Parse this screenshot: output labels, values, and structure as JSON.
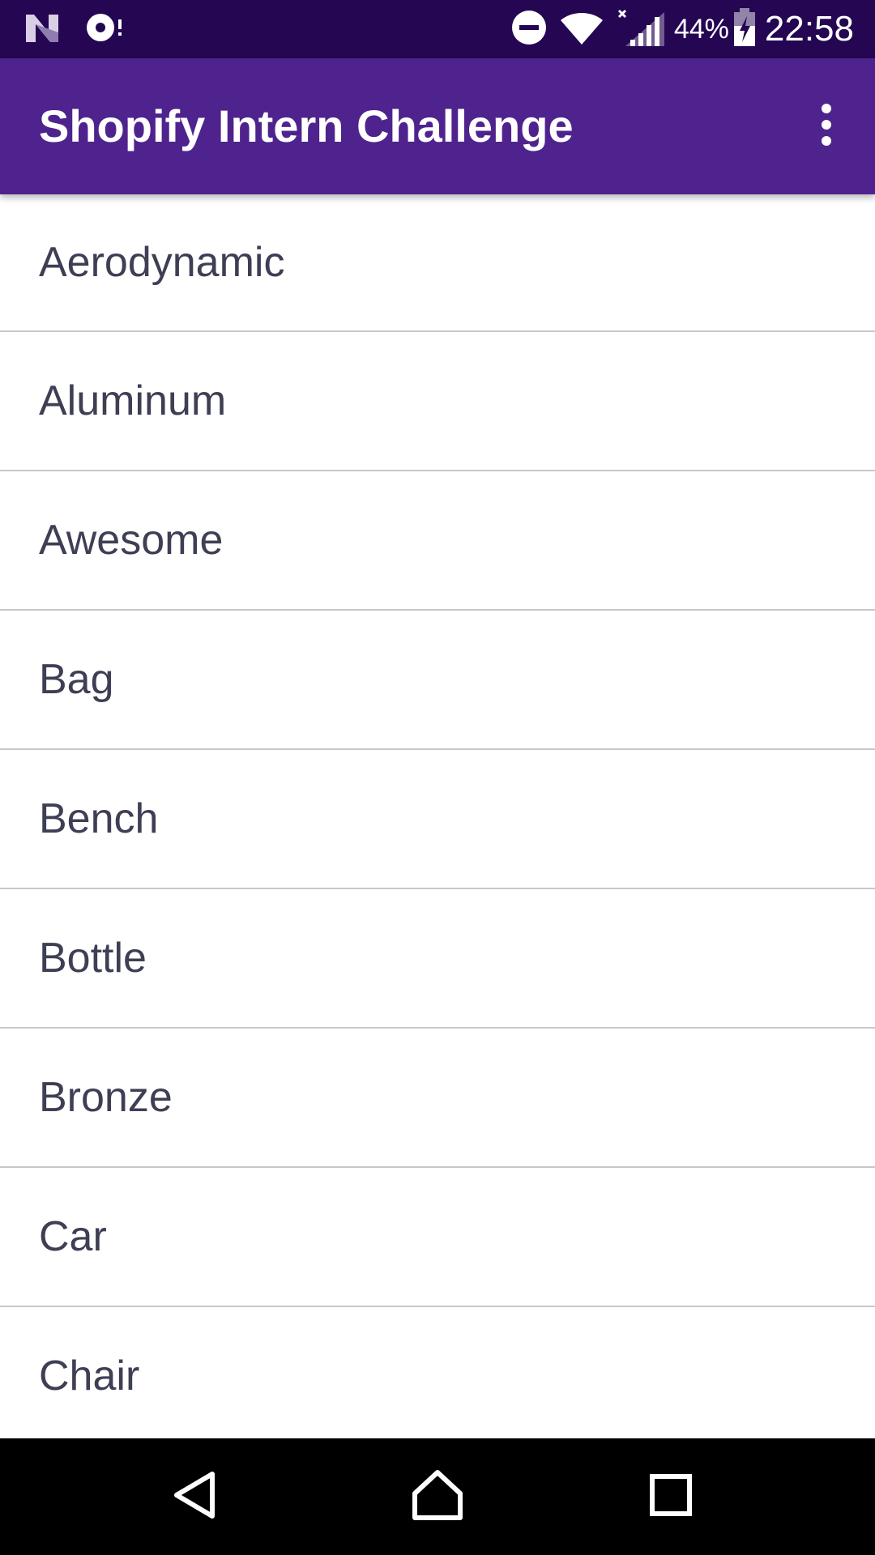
{
  "status_bar": {
    "battery_percent": "44%",
    "time": "22:58",
    "icons": [
      "notification-n-icon",
      "media-icon",
      "do-not-disturb-icon",
      "wifi-icon",
      "cellular-signal-icon",
      "battery-charging-icon"
    ]
  },
  "app_bar": {
    "title": "Shopify Intern Challenge",
    "overflow_icon": "more-vert-icon"
  },
  "list": {
    "items": [
      {
        "label": "Aerodynamic"
      },
      {
        "label": "Aluminum"
      },
      {
        "label": "Awesome"
      },
      {
        "label": "Bag"
      },
      {
        "label": "Bench"
      },
      {
        "label": "Bottle"
      },
      {
        "label": "Bronze"
      },
      {
        "label": "Car"
      },
      {
        "label": "Chair"
      }
    ]
  },
  "nav_bar": {
    "icons": [
      "back-icon",
      "home-icon",
      "recents-icon"
    ]
  },
  "colors": {
    "status_bar": "#240652",
    "app_bar": "#4f238d",
    "list_text": "#3e3f54",
    "divider": "#c8c8c8"
  }
}
